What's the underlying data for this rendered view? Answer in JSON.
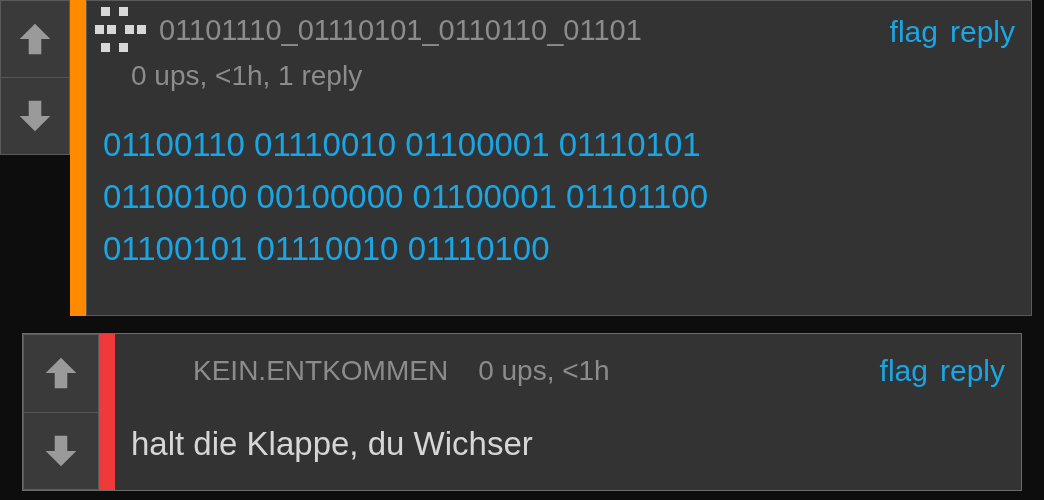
{
  "comments": [
    {
      "kind": "top",
      "username": "01101110_01110101_0110110_01101",
      "meta": "0 ups, <1h, 1 reply",
      "actions": [
        "flag",
        "reply"
      ],
      "color": "#ff8a00",
      "text": "01100110 01110010 01100001 01110101\n01100100 00100000 01100001 01101100\n01100101 01110010 01110100"
    },
    {
      "kind": "reply",
      "username": "KEIN.ENTKOMMEN",
      "meta": "0 ups, <1h",
      "actions": [
        "flag",
        "reply"
      ],
      "color": "#f03a3a",
      "text": "halt die Klappe, du Wichser"
    }
  ]
}
